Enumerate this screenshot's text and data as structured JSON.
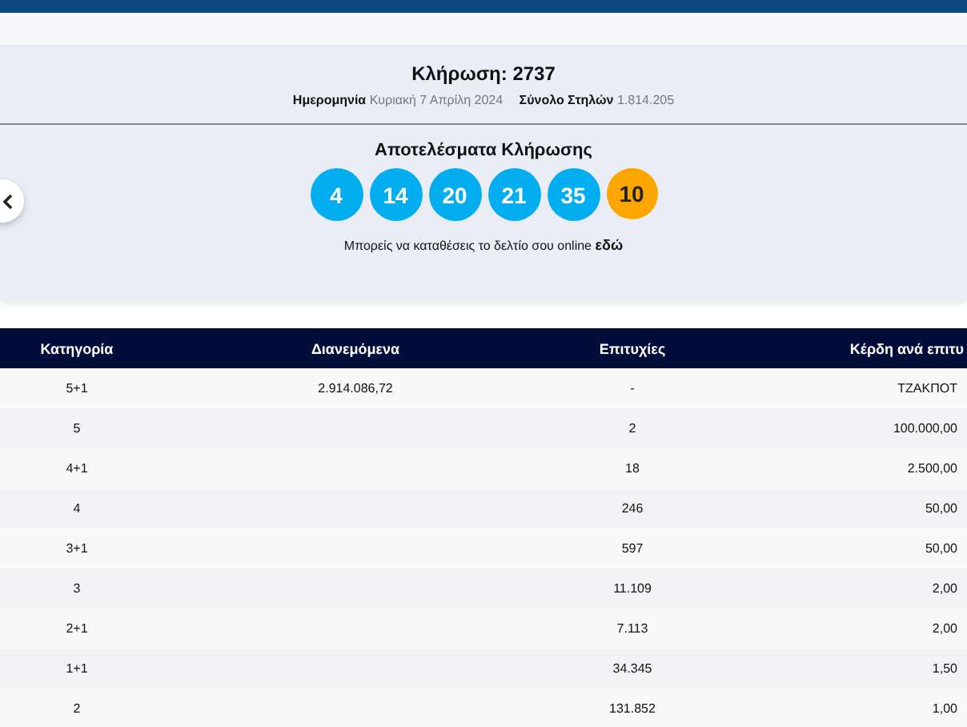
{
  "draw": {
    "title": "Κλήρωση: 2737",
    "date_label": "Ημερομηνία",
    "date_value": "Κυριακή 7 Απρίλη 2024",
    "total_label": "Σύνολο Στηλών",
    "total_value": "1.814.205"
  },
  "results": {
    "title": "Αποτελέσματα Κλήρωσης",
    "balls": [
      {
        "number": "4",
        "kind": "main"
      },
      {
        "number": "14",
        "kind": "main"
      },
      {
        "number": "20",
        "kind": "main"
      },
      {
        "number": "21",
        "kind": "main"
      },
      {
        "number": "35",
        "kind": "main"
      },
      {
        "number": "10",
        "kind": "bonus"
      }
    ],
    "note": "Μπορείς να καταθέσεις το δελτίο σου online",
    "note_link": "εδώ"
  },
  "table": {
    "columns": [
      "Κατηγορία",
      "Διανεμόμενα",
      "Επιτυχίες",
      "Κέρδη ανά επιτυ"
    ],
    "rows": [
      [
        "5+1",
        "2.914.086,72",
        "-",
        "ΤΖΑΚΠΟΤ"
      ],
      [
        "5",
        "",
        "2",
        "100.000,00"
      ],
      [
        "4+1",
        "",
        "18",
        "2.500,00"
      ],
      [
        "4",
        "",
        "246",
        "50,00"
      ],
      [
        "3+1",
        "",
        "597",
        "50,00"
      ],
      [
        "3",
        "",
        "11.109",
        "2,00"
      ],
      [
        "2+1",
        "",
        "7.113",
        "2,00"
      ],
      [
        "1+1",
        "",
        "34.345",
        "1,50"
      ],
      [
        "2",
        "",
        "131.852",
        "1,00"
      ]
    ]
  }
}
